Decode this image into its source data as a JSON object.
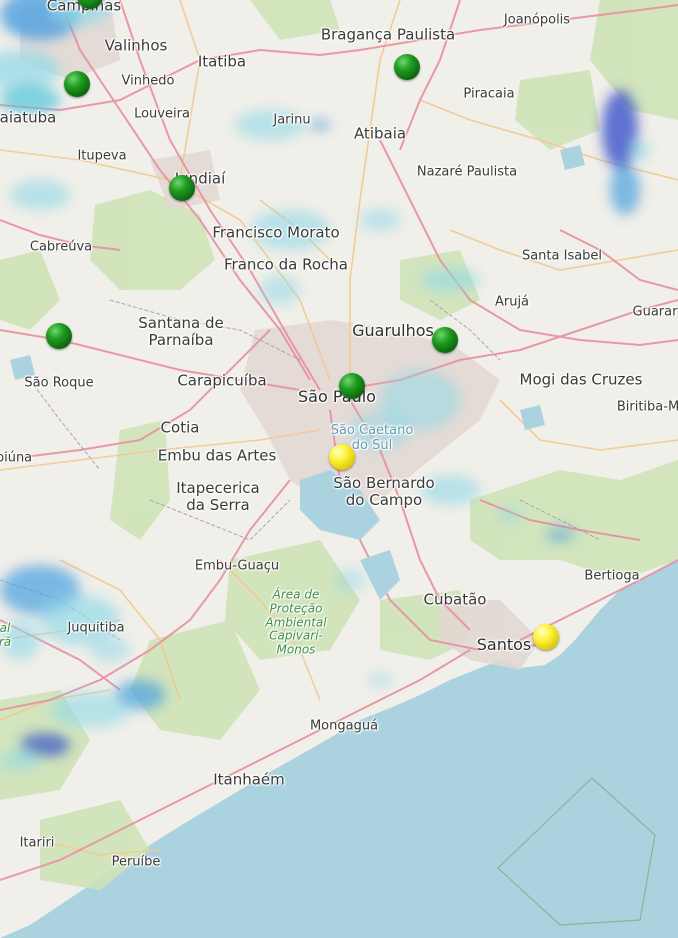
{
  "map": {
    "colors": {
      "land": "#f1efe9",
      "sea": "#aad3df",
      "forest": "#cfe3b8",
      "urban": "#e2d7d2",
      "major_road": "#e88fa2",
      "secondary_road": "#f2c98f",
      "radar_light": "#8fd8e8",
      "radar_medium": "#4a9fe0",
      "radar_heavy": "#2c46c8",
      "marker_green": "#1a8f1a",
      "marker_yellow": "#f2e600"
    },
    "labels": {
      "campinas": "Campinas",
      "valinhos": "Valinhos",
      "itatiba": "Itatiba",
      "braganca_paulista": "Bragança Paulista",
      "joanopolis": "Joanópolis",
      "vinhedo": "Vinhedo",
      "indaiatuba": "aiatuba",
      "louveira": "Louveira",
      "jarinu": "Jarinu",
      "atibaia": "Atibaia",
      "piracaia": "Piracaia",
      "itupeva": "Itupeva",
      "jundiai": "Jundiaí",
      "nazare_paulista": "Nazaré Paulista",
      "cabreuva": "Cabreúva",
      "francisco_morato": "Francisco Morato",
      "franco_da_rocha": "Franco da Rocha",
      "santa_isabel": "Santa Isabel",
      "aruja": "Arujá",
      "guararema": "Guarar",
      "santana_de_parnaiba": "Santana de\nParnaíba",
      "guarulhos": "Guarulhos",
      "sao_roque": "São Roque",
      "carapicuiba": "Carapicuíba",
      "sao_paulo": "São Paulo",
      "mogi_das_cruzes": "Mogi das Cruzes",
      "biritiba_mirim": "Biritiba-M",
      "cotia": "Cotia",
      "sao_caetano_do_sul": "São Caetano\ndo Sul",
      "ibiuna": "biúna",
      "embu_das_artes": "Embu das Artes",
      "itapecerica_da_serra": "Itapecerica\nda Serra",
      "sao_bernardo_do_campo": "São Bernardo\ndo Campo",
      "embu_guacu": "Embu-Guaçu",
      "area_protecao": "Área de\nProteção\nAmbiental\nCapivari-\nMonos",
      "bertioga": "Bertioga",
      "cubatao": "Cubatão",
      "juquitiba": "Juquitiba",
      "santos": "Santos",
      "mongagua": "Mongaguá",
      "itanhaem": "Itanhaém",
      "itariri": "Itariri",
      "peruibe": "Peruíbe",
      "left_edge_fragment": "al\nrã"
    },
    "markers": [
      {
        "color": "green",
        "near": "Campinas"
      },
      {
        "color": "green",
        "near": "Vinhedo"
      },
      {
        "color": "green",
        "near": "Bragança Paulista"
      },
      {
        "color": "green",
        "near": "Jundiaí"
      },
      {
        "color": "green",
        "near": "São Roque"
      },
      {
        "color": "green",
        "near": "Guarulhos"
      },
      {
        "color": "green",
        "near": "São Paulo"
      },
      {
        "color": "yellow",
        "near": "São Caetano do Sul"
      },
      {
        "color": "yellow",
        "near": "Santos"
      }
    ]
  }
}
